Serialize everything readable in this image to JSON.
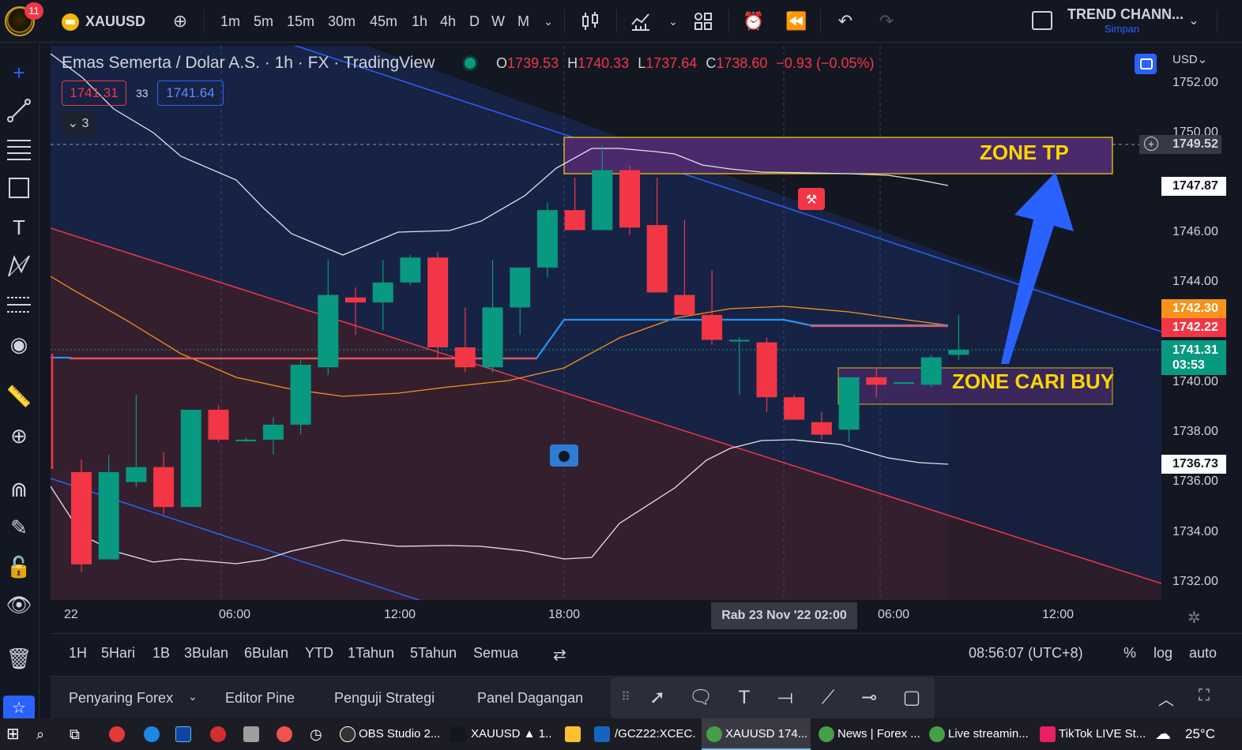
{
  "topbar": {
    "notif_count": "11",
    "symbol": "XAUUSD",
    "intervals": [
      "1m",
      "5m",
      "15m",
      "30m",
      "45m",
      "1h",
      "4h",
      "D",
      "W",
      "M"
    ],
    "active_interval": "1h",
    "layout_name": "TREND CHANN...",
    "layout_save": "Simpan"
  },
  "legend": {
    "title": "Emas Semerta / Dolar A.S. · 1h · FX · TradingView",
    "o_label": "O",
    "o": "1739.53",
    "h_label": "H",
    "h": "1740.33",
    "l_label": "L",
    "l": "1737.64",
    "c_label": "C",
    "c": "1738.60",
    "change": "−0.93 (−0.05%)",
    "bid": "1741.31",
    "spread": "33",
    "ask": "1741.64",
    "indicators_toggle": "⌄ 3"
  },
  "annotations": {
    "zone_tp": "ZONE TP",
    "zone_buy": "ZONE CARI BUY"
  },
  "price_axis": {
    "currency": "USD⌄",
    "ticks": [
      "1752.00",
      "1750.00",
      "1746.00",
      "1744.00",
      "1740.00",
      "1738.00",
      "1736.00",
      "1734.00",
      "1732.00"
    ],
    "crosshair_price": "1749.52",
    "label_upper_band": "1747.87",
    "label_orange": "1742.30",
    "label_red": "1742.22",
    "current_price": "1741.31",
    "countdown": "03:53",
    "label_lower_band": "1736.73"
  },
  "time_axis": {
    "ticks": [
      "22",
      "06:00",
      "12:00",
      "18:00",
      "06:00",
      "12:00"
    ],
    "crosshair_time": "Rab 23 Nov '22   02:00"
  },
  "range_bar": {
    "ranges": [
      "1H",
      "5Hari",
      "1B",
      "3Bulan",
      "6Bulan",
      "YTD",
      "1Tahun",
      "5Tahun",
      "Semua"
    ],
    "clock": "08:56:07 (UTC+8)",
    "percent": "%",
    "log": "log",
    "auto": "auto"
  },
  "bottom_panel": {
    "tabs": [
      "Penyaring Forex",
      "Editor Pine",
      "Penguji Strategi",
      "Panel Dagangan"
    ]
  },
  "taskbar": {
    "items": [
      "OBS Studio 2...",
      "XAUUSD ▲ 1...",
      "/GCZ22:XCEC...",
      "XAUUSD 174...",
      "News | Forex ...",
      "Live streamin...",
      "TikTok LIVE St..."
    ],
    "temperature": "25°C"
  },
  "chart_data": {
    "type": "candlestick",
    "symbol": "XAUUSD",
    "interval": "1h",
    "y_range": [
      1731.2,
      1752.6
    ],
    "candles": [
      {
        "o": 1736.4,
        "h": 1736.9,
        "c": 1732.7,
        "l": 1732.4
      },
      {
        "o": 1732.9,
        "h": 1737.1,
        "c": 1736.4,
        "l": 1732.9
      },
      {
        "o": 1736.0,
        "h": 1739.5,
        "c": 1736.6,
        "l": 1735.8
      },
      {
        "o": 1736.6,
        "h": 1737.2,
        "c": 1735.0,
        "l": 1734.7
      },
      {
        "o": 1735.0,
        "h": 1738.9,
        "c": 1738.9,
        "l": 1735.0
      },
      {
        "o": 1738.9,
        "h": 1739.1,
        "c": 1737.7,
        "l": 1737.6
      },
      {
        "o": 1737.7,
        "h": 1737.8,
        "c": 1737.7,
        "l": 1737.6
      },
      {
        "o": 1737.7,
        "h": 1738.6,
        "c": 1738.3,
        "l": 1737.1
      },
      {
        "o": 1738.3,
        "h": 1740.9,
        "c": 1740.7,
        "l": 1737.9
      },
      {
        "o": 1740.6,
        "h": 1744.9,
        "c": 1743.5,
        "l": 1740.3
      },
      {
        "o": 1743.4,
        "h": 1743.8,
        "c": 1743.2,
        "l": 1741.9
      },
      {
        "o": 1743.2,
        "h": 1744.9,
        "c": 1744.0,
        "l": 1742.1
      },
      {
        "o": 1744.0,
        "h": 1745.1,
        "c": 1745.0,
        "l": 1743.9
      },
      {
        "o": 1745.0,
        "h": 1745.2,
        "c": 1741.4,
        "l": 1740.9
      },
      {
        "o": 1741.4,
        "h": 1743.0,
        "c": 1740.6,
        "l": 1740.4
      },
      {
        "o": 1740.6,
        "h": 1744.9,
        "c": 1743.0,
        "l": 1740.4
      },
      {
        "o": 1743.0,
        "h": 1744.6,
        "c": 1744.6,
        "l": 1741.9
      },
      {
        "o": 1744.6,
        "h": 1747.2,
        "c": 1746.9,
        "l": 1744.2
      },
      {
        "o": 1746.9,
        "h": 1748.2,
        "c": 1746.1,
        "l": 1746.1
      },
      {
        "o": 1746.1,
        "h": 1749.5,
        "c": 1748.5,
        "l": 1746.1
      },
      {
        "o": 1748.5,
        "h": 1748.7,
        "c": 1746.2,
        "l": 1745.9
      },
      {
        "o": 1746.3,
        "h": 1748.2,
        "c": 1743.6,
        "l": 1743.6
      },
      {
        "o": 1743.5,
        "h": 1746.5,
        "c": 1742.7,
        "l": 1742.6
      },
      {
        "o": 1742.7,
        "h": 1744.5,
        "c": 1741.7,
        "l": 1741.5
      },
      {
        "o": 1741.7,
        "h": 1741.8,
        "c": 1741.7,
        "l": 1739.5
      },
      {
        "o": 1741.6,
        "h": 1741.8,
        "c": 1739.4,
        "l": 1738.8
      },
      {
        "o": 1739.4,
        "h": 1739.5,
        "c": 1738.5,
        "l": 1738.5
      },
      {
        "o": 1738.4,
        "h": 1738.8,
        "c": 1737.9,
        "l": 1737.7
      },
      {
        "o": 1738.1,
        "h": 1740.1,
        "c": 1740.2,
        "l": 1737.6
      },
      {
        "o": 1740.2,
        "h": 1740.6,
        "c": 1739.9,
        "l": 1739.4
      },
      {
        "o": 1740.0,
        "h": 1740.0,
        "c": 1740.0,
        "l": 1740.0
      },
      {
        "o": 1739.9,
        "h": 1741.1,
        "c": 1741.0,
        "l": 1739.8
      },
      {
        "o": 1741.1,
        "h": 1742.7,
        "c": 1741.3,
        "l": 1740.9
      }
    ],
    "colors": {
      "up": "#089981",
      "down": "#f23645",
      "upper_channel": "#2962ff",
      "lower_channel": "#f23645",
      "bollinger": "#e0e3eb",
      "ma_orange": "#f7931a",
      "stop_line_blue": "#2196f3",
      "stop_line_red": "#ef5350",
      "zone_fill": "#4a2a6a",
      "zone_border": "#ffd600",
      "arrow": "#2962ff"
    }
  }
}
